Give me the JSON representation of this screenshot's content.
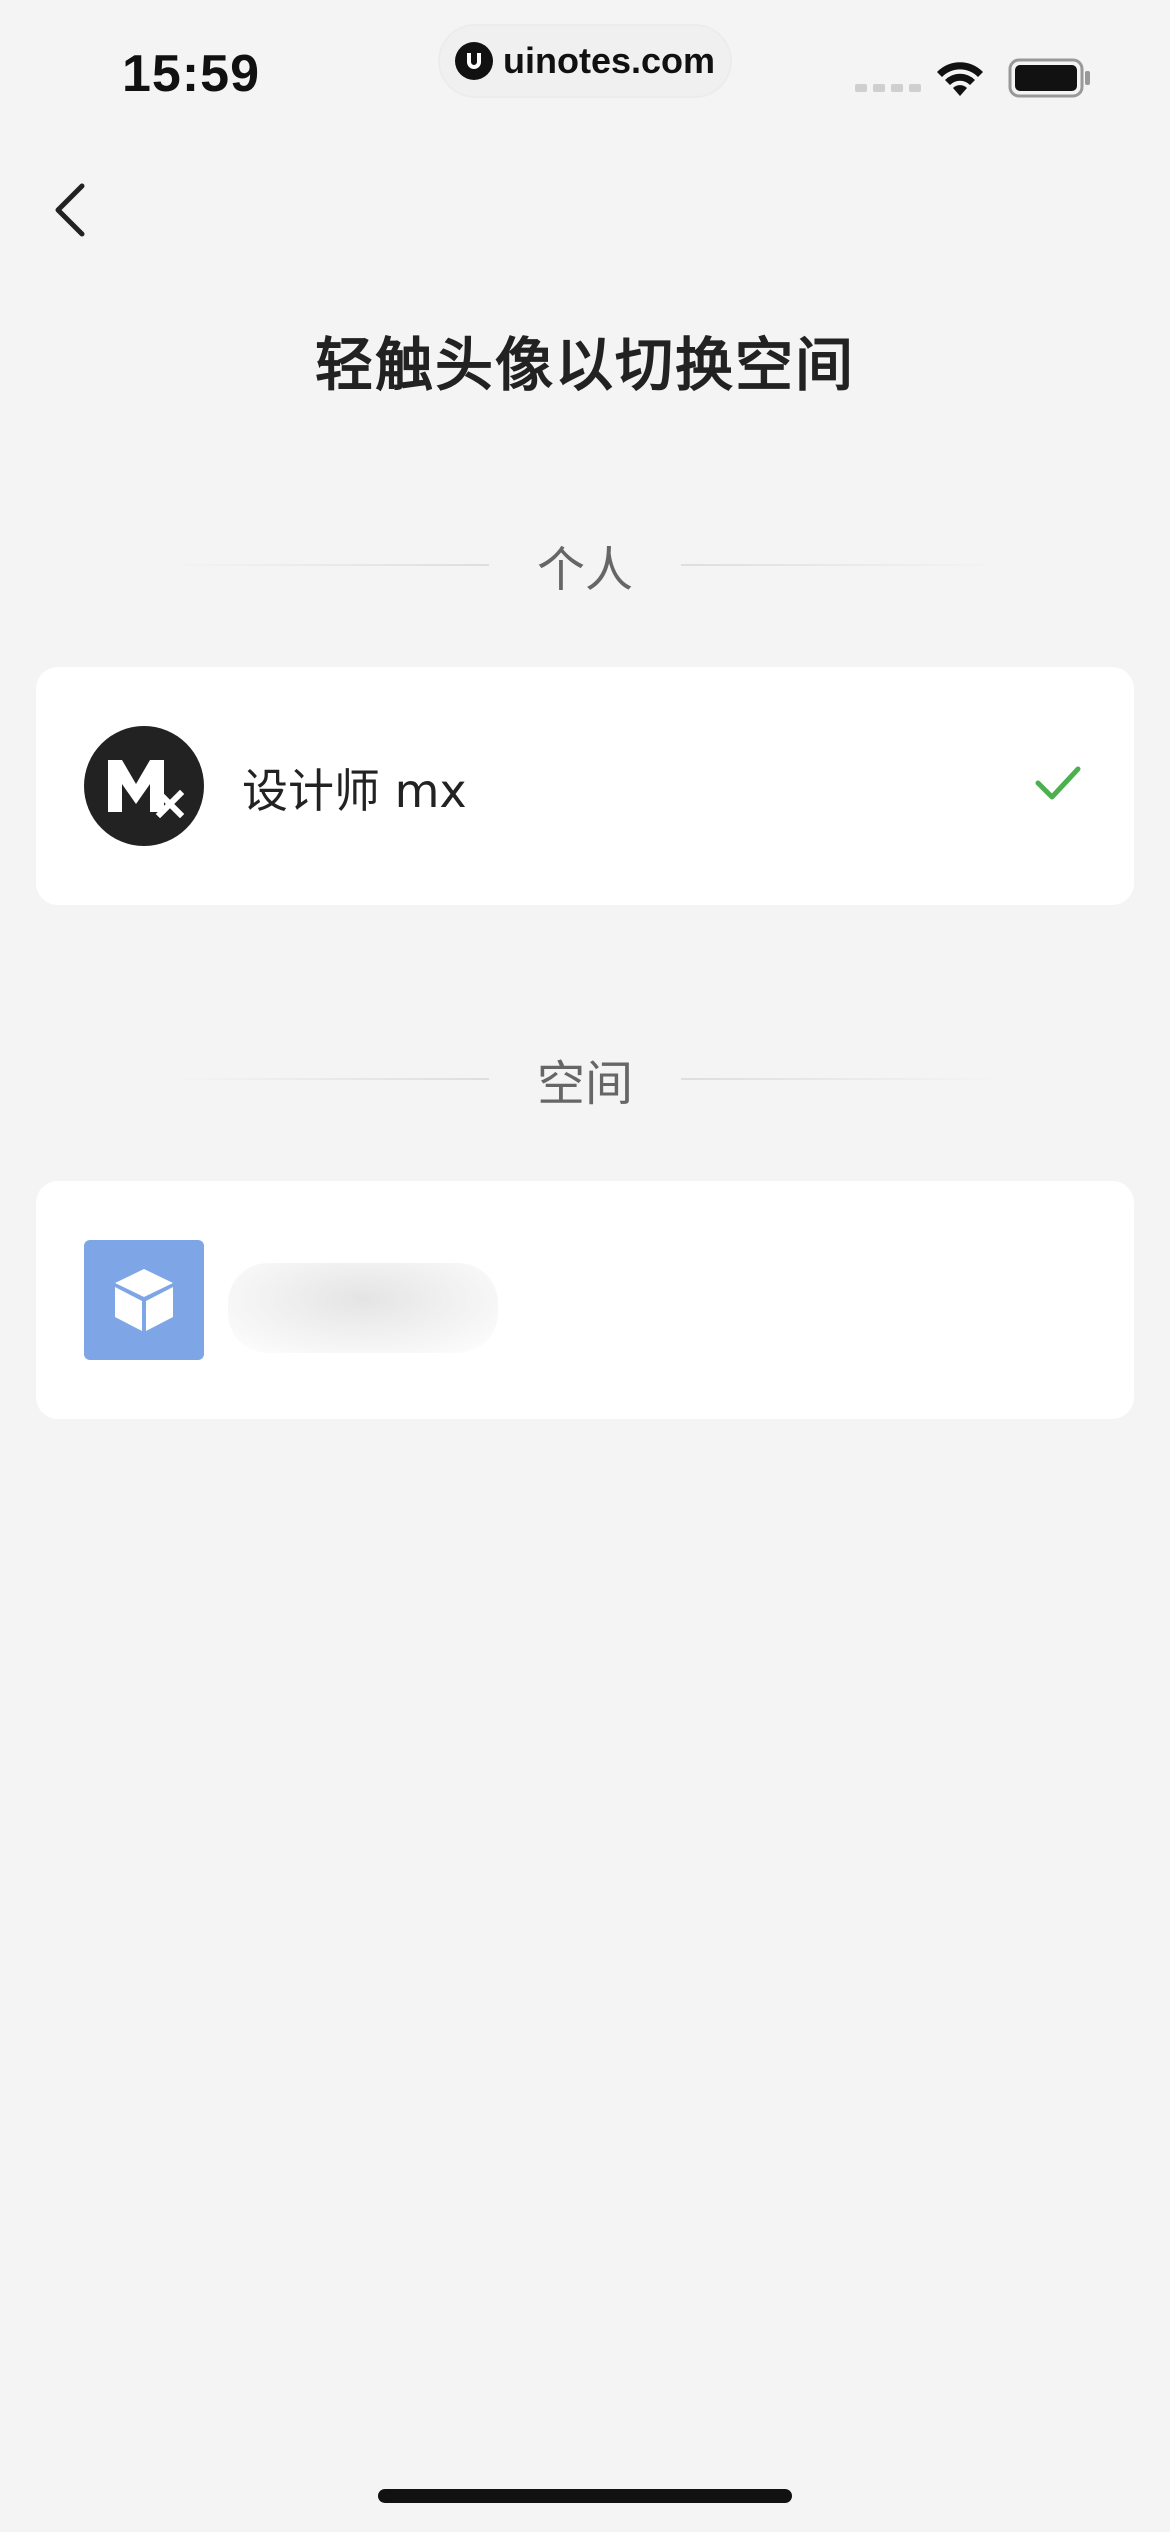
{
  "status_bar": {
    "time": "15:59",
    "watermark": "uinotes.com",
    "icons": [
      "signal-icon",
      "wifi-icon",
      "battery-icon"
    ]
  },
  "nav": {
    "back_icon": "chevron-left-icon"
  },
  "page": {
    "title": "轻触头像以切换空间"
  },
  "personal_section": {
    "label": "个人",
    "account": {
      "avatar_text": "Mx",
      "name": "设计师 mx",
      "selected": true,
      "check_color": "#4caf50"
    }
  },
  "spaces_section": {
    "label": "空间",
    "items": [
      {
        "avatar_icon": "cube-icon",
        "avatar_color": "#7ea6e6",
        "name_blurred": true
      }
    ]
  },
  "colors": {
    "background": "#f4f4f4",
    "card": "#ffffff",
    "accent_check": "#4caf50"
  }
}
